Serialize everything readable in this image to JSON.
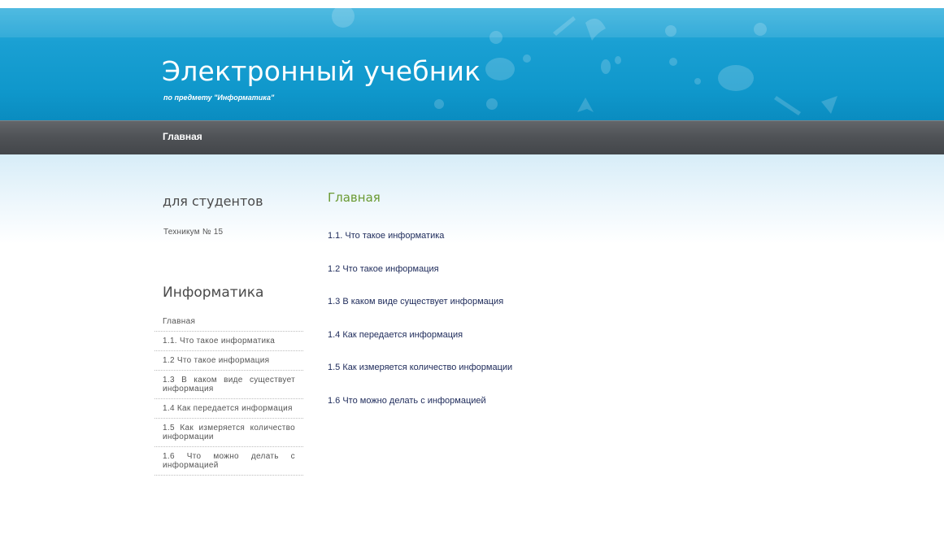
{
  "header": {
    "title": "Электронный учебник",
    "subtitle": "по предмету \"Информатика\""
  },
  "nav": {
    "items": [
      {
        "label": "Главная"
      }
    ]
  },
  "sidebar": {
    "section1": {
      "heading": "для студентов",
      "text": "Техникум № 15"
    },
    "section2": {
      "heading": "Информатика",
      "menu": [
        "Главная",
        "1.1. Что такое информатика",
        "1.2 Что такое информация",
        "1.3 В каком виде существует информация",
        "1.4 Как передается информация",
        "1.5 Как измеряется количество информации",
        "1.6 Что можно делать с информацией"
      ]
    }
  },
  "main": {
    "title": "Главная",
    "links": [
      "1.1. Что такое информатика",
      "1.2 Что такое информация",
      "1.3 В каком виде существует информация",
      "1.4 Как передается информация",
      "1.5 Как измеряется количество информации",
      "1.6 Что можно делать с информацией"
    ]
  },
  "colors": {
    "header_blue": "#1aa0d3",
    "nav_gray": "#505357",
    "main_title_green": "#6a9a32",
    "link_navy": "#1d2a5a",
    "sidebar_text": "#555555"
  }
}
